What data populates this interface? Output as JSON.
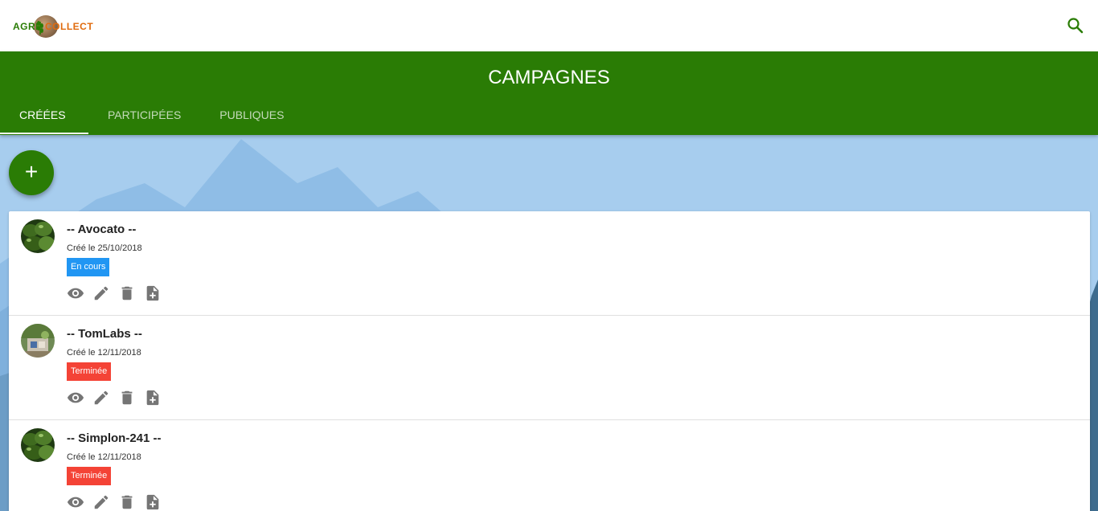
{
  "header": {
    "logo": {
      "part1": "AGRI",
      "part2": "COLLECT"
    },
    "search_icon": "search-icon",
    "accent": "#2a7c05"
  },
  "appbar": {
    "title": "CAMPAGNES",
    "tabs": [
      {
        "label": "CRÉÉES",
        "active": true
      },
      {
        "label": "PARTICIPÉES",
        "active": false
      },
      {
        "label": "PUBLIQUES",
        "active": false
      }
    ]
  },
  "fab": {
    "label": "+"
  },
  "campaigns": [
    {
      "title": "-- Avocato --",
      "date": "Créé le 25/10/2018",
      "status": "En cours",
      "status_color": "#2196f3",
      "avatar": "avocado-image"
    },
    {
      "title": "-- TomLabs --",
      "date": "Créé le 12/11/2018",
      "status": "Terminée",
      "status_color": "#f44336",
      "avatar": "lab-image"
    },
    {
      "title": "-- Simplon-241 --",
      "date": "Créé le 12/11/2018",
      "status": "Terminée",
      "status_color": "#f44336",
      "avatar": "avocado-image"
    }
  ],
  "item_actions": [
    "eye-icon",
    "pencil-icon",
    "trash-icon",
    "add-file-icon"
  ]
}
